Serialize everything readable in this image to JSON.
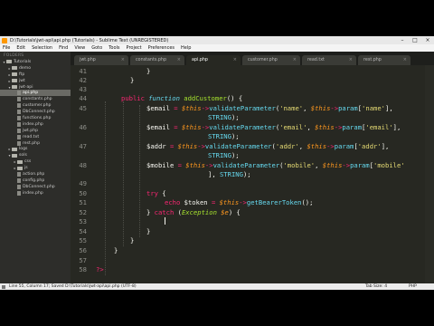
{
  "window": {
    "title": "D:\\Tutorials\\jwt-api\\api.php (Tutorials) - Sublime Text (UNREGISTERED)"
  },
  "menu": [
    "File",
    "Edit",
    "Selection",
    "Find",
    "View",
    "Goto",
    "Tools",
    "Project",
    "Preferences",
    "Help"
  ],
  "sidebar": {
    "header": "FOLDERS",
    "items": [
      {
        "label": "Tutorials",
        "type": "folder",
        "open": true,
        "depth": 0
      },
      {
        "label": "demo",
        "type": "folder",
        "open": false,
        "depth": 1
      },
      {
        "label": "ftp",
        "type": "folder",
        "open": false,
        "depth": 1
      },
      {
        "label": "jwt",
        "type": "folder",
        "open": false,
        "depth": 1
      },
      {
        "label": "jwt-api",
        "type": "folder",
        "open": true,
        "depth": 1
      },
      {
        "label": "api.php",
        "type": "file",
        "depth": 2,
        "selected": true
      },
      {
        "label": "constants.php",
        "type": "file",
        "depth": 2
      },
      {
        "label": "customer.php",
        "type": "file",
        "depth": 2
      },
      {
        "label": "DbConnect.php",
        "type": "file",
        "depth": 2
      },
      {
        "label": "functions.php",
        "type": "file",
        "depth": 2
      },
      {
        "label": "index.php",
        "type": "file",
        "depth": 2
      },
      {
        "label": "jwt.php",
        "type": "file",
        "depth": 2
      },
      {
        "label": "read.txt",
        "type": "file",
        "depth": 2
      },
      {
        "label": "rest.php",
        "type": "file",
        "depth": 2
      },
      {
        "label": "logs",
        "type": "folder",
        "open": false,
        "depth": 1
      },
      {
        "label": "sols",
        "type": "folder",
        "open": true,
        "depth": 1
      },
      {
        "label": "css",
        "type": "folder",
        "open": false,
        "depth": 2
      },
      {
        "label": "js",
        "type": "folder",
        "open": false,
        "depth": 2
      },
      {
        "label": "action.php",
        "type": "file",
        "depth": 2
      },
      {
        "label": "config.php",
        "type": "file",
        "depth": 2
      },
      {
        "label": "DbConnect.php",
        "type": "file",
        "depth": 2
      },
      {
        "label": "index.php",
        "type": "file",
        "depth": 2
      }
    ]
  },
  "tabs": [
    {
      "label": "jwt.php",
      "active": false
    },
    {
      "label": "constants.php",
      "active": false
    },
    {
      "label": "api.php",
      "active": true
    },
    {
      "label": "customer.php",
      "active": false
    },
    {
      "label": "read.txt",
      "active": false
    },
    {
      "label": "rest.php",
      "active": false
    }
  ],
  "tab_close_glyph": "×",
  "editor": {
    "line_numbers": [
      "41",
      "42",
      "43",
      "44",
      "45",
      "",
      "46",
      "",
      "47",
      "",
      "48",
      "",
      "49",
      "50",
      "51",
      "52",
      "53",
      "54",
      "55",
      "56",
      "57",
      "58"
    ],
    "lines": [
      [
        [
          "}",
          "p"
        ]
      ],
      [
        [
          "}",
          "p"
        ]
      ],
      [],
      [
        [
          "public",
          "k"
        ],
        [
          " ",
          "p"
        ],
        [
          "function",
          "sk"
        ],
        [
          " ",
          "p"
        ],
        [
          "addCustomer",
          "fn"
        ],
        [
          "() {",
          "p"
        ]
      ],
      [
        [
          "$email",
          "v"
        ],
        [
          " ",
          "p"
        ],
        [
          "=",
          "k"
        ],
        [
          " ",
          "p"
        ],
        [
          "$this",
          "th"
        ],
        [
          "->",
          "k"
        ],
        [
          "validateParameter",
          "c"
        ],
        [
          "(",
          "p"
        ],
        [
          "'name'",
          "s"
        ],
        [
          ", ",
          "p"
        ],
        [
          "$this",
          "th"
        ],
        [
          "->",
          "k"
        ],
        [
          "param",
          "c"
        ],
        [
          "[",
          "p"
        ],
        [
          "'name'",
          "s"
        ],
        [
          "],",
          "p"
        ]
      ],
      [
        [
          "STRING",
          "c"
        ],
        [
          ");",
          "p"
        ]
      ],
      [
        [
          "$email",
          "v"
        ],
        [
          " ",
          "p"
        ],
        [
          "=",
          "k"
        ],
        [
          " ",
          "p"
        ],
        [
          "$this",
          "th"
        ],
        [
          "->",
          "k"
        ],
        [
          "validateParameter",
          "c"
        ],
        [
          "(",
          "p"
        ],
        [
          "'email'",
          "s"
        ],
        [
          ", ",
          "p"
        ],
        [
          "$this",
          "th"
        ],
        [
          "->",
          "k"
        ],
        [
          "param",
          "c"
        ],
        [
          "[",
          "p"
        ],
        [
          "'email'",
          "s"
        ],
        [
          "],",
          "p"
        ]
      ],
      [
        [
          "STRING",
          "c"
        ],
        [
          ");",
          "p"
        ]
      ],
      [
        [
          "$addr",
          "v"
        ],
        [
          " ",
          "p"
        ],
        [
          "=",
          "k"
        ],
        [
          " ",
          "p"
        ],
        [
          "$this",
          "th"
        ],
        [
          "->",
          "k"
        ],
        [
          "validateParameter",
          "c"
        ],
        [
          "(",
          "p"
        ],
        [
          "'addr'",
          "s"
        ],
        [
          ", ",
          "p"
        ],
        [
          "$this",
          "th"
        ],
        [
          "->",
          "k"
        ],
        [
          "param",
          "c"
        ],
        [
          "[",
          "p"
        ],
        [
          "'addr'",
          "s"
        ],
        [
          "],",
          "p"
        ]
      ],
      [
        [
          "STRING",
          "c"
        ],
        [
          ");",
          "p"
        ]
      ],
      [
        [
          "$mobile",
          "v"
        ],
        [
          " ",
          "p"
        ],
        [
          "=",
          "k"
        ],
        [
          " ",
          "p"
        ],
        [
          "$this",
          "th"
        ],
        [
          "->",
          "k"
        ],
        [
          "validateParameter",
          "c"
        ],
        [
          "(",
          "p"
        ],
        [
          "'mobile'",
          "s"
        ],
        [
          ", ",
          "p"
        ],
        [
          "$this",
          "th"
        ],
        [
          "->",
          "k"
        ],
        [
          "param",
          "c"
        ],
        [
          "[",
          "p"
        ],
        [
          "'mobile'",
          "s"
        ]
      ],
      [
        [
          "], ",
          "p"
        ],
        [
          "STRING",
          "c"
        ],
        [
          ");",
          "p"
        ]
      ],
      [],
      [
        [
          "try",
          "k"
        ],
        [
          " {",
          "p"
        ]
      ],
      [
        [
          "echo",
          "k"
        ],
        [
          " ",
          "p"
        ],
        [
          "$token",
          "v"
        ],
        [
          " ",
          "p"
        ],
        [
          "=",
          "k"
        ],
        [
          " ",
          "p"
        ],
        [
          "$this",
          "th"
        ],
        [
          "->",
          "k"
        ],
        [
          "getBearerToken",
          "c"
        ],
        [
          "();",
          "p"
        ]
      ],
      [
        [
          "} ",
          "p"
        ],
        [
          "catch",
          "k"
        ],
        [
          " (",
          "p"
        ],
        [
          "Exception",
          "ex"
        ],
        [
          " ",
          "p"
        ],
        [
          "$e",
          "th"
        ],
        [
          ") {",
          "p"
        ]
      ],
      [],
      [
        [
          "}",
          "p"
        ]
      ],
      [
        [
          "}",
          "p"
        ]
      ],
      [
        [
          "}",
          "p"
        ]
      ],
      [],
      [
        [
          "?>",
          "k"
        ]
      ]
    ]
  },
  "status": {
    "left": "Line 55, Column 17; Saved D:\\Tutorials\\jwt-api\\api.php (UTF-8)",
    "tab_size": "Tab Size: 4",
    "syntax": "PHP"
  }
}
